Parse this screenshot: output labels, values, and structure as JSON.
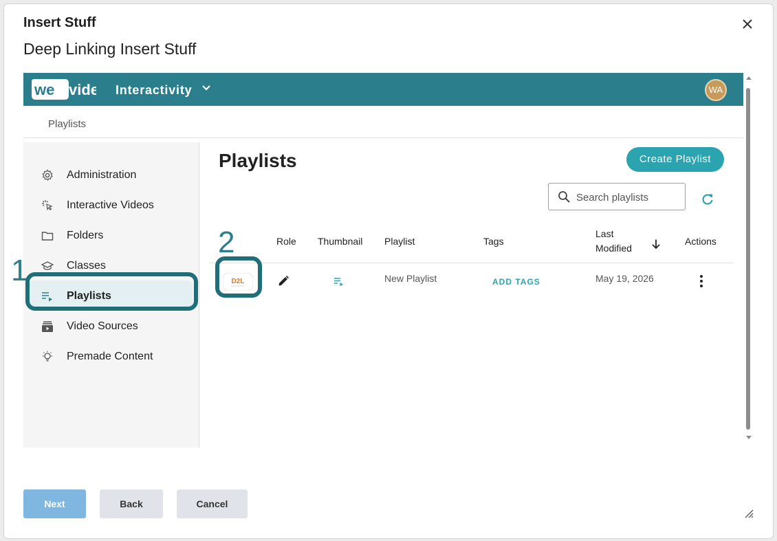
{
  "dialog": {
    "title": "Insert Stuff",
    "subtitle": "Deep Linking Insert Stuff",
    "close_icon": "close-icon"
  },
  "app": {
    "logo_text": "wevideo",
    "name": "Interactivity",
    "user_initials": "WA",
    "brand_color": "#2b7f8c",
    "accent_color": "#2ba4b0"
  },
  "breadcrumb": "Playlists",
  "sidebar": {
    "items": [
      {
        "label": "Administration",
        "icon": "gear-icon"
      },
      {
        "label": "Interactive Videos",
        "icon": "cursor-click-icon"
      },
      {
        "label": "Folders",
        "icon": "folder-icon"
      },
      {
        "label": "Classes",
        "icon": "graduation-cap-icon"
      },
      {
        "label": "Playlists",
        "icon": "playlist-icon",
        "active": true
      },
      {
        "label": "Video Sources",
        "icon": "video-stack-icon"
      },
      {
        "label": "Premade Content",
        "icon": "lightbulb-icon"
      }
    ]
  },
  "main": {
    "title": "Playlists",
    "create_button": "Create Playlist",
    "search_placeholder": "Search playlists"
  },
  "table": {
    "headers": [
      "Role",
      "Thumbnail",
      "Playlist",
      "Tags",
      "Last",
      "Modified",
      "Actions"
    ],
    "rows": [
      {
        "source_badge": "D2L",
        "role_icon": "pencil-icon",
        "thumbnail_icon": "playlist-icon",
        "playlist": "New Playlist",
        "tags": "ADD TAGS",
        "last_modified": "May 19, 2026",
        "actions_icon": "kebab-menu-icon"
      }
    ]
  },
  "annotations": [
    "1",
    "2"
  ],
  "footer": {
    "next": "Next",
    "back": "Back",
    "cancel": "Cancel"
  }
}
